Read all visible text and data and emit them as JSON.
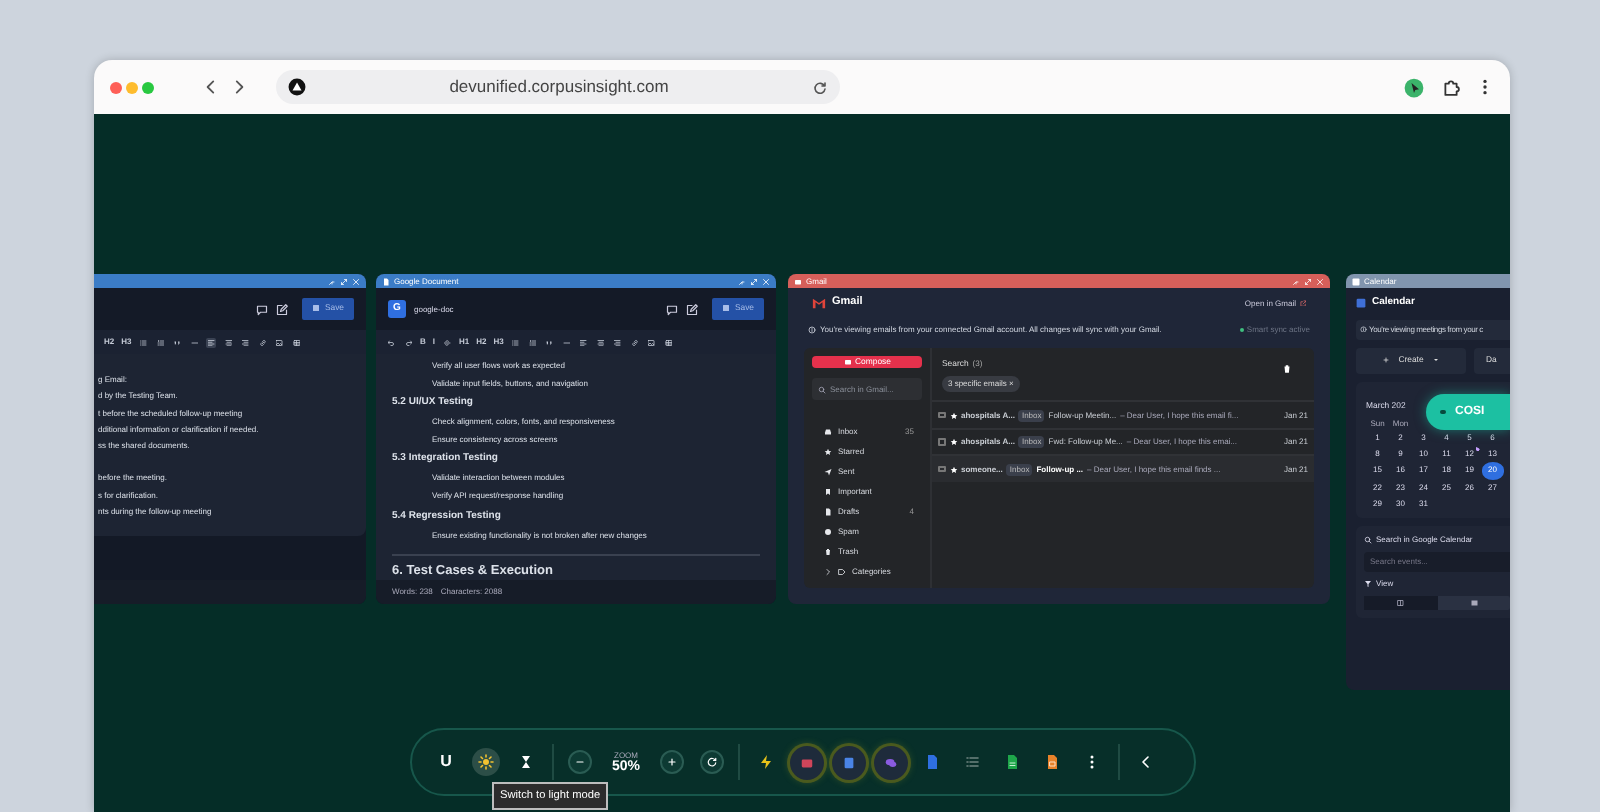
{
  "browser": {
    "url": "devunified.corpusinsight.com"
  },
  "windows": [
    {
      "kind": "doc",
      "save": "Save",
      "toolbar": [
        {
          "kind": "text",
          "label": "H2",
          "selected": false
        },
        {
          "kind": "text",
          "label": "H3",
          "selected": false
        },
        {
          "kind": "icon",
          "selected": false
        },
        {
          "kind": "icon",
          "selected": false
        },
        {
          "kind": "icon",
          "selected": false
        },
        {
          "kind": "icon",
          "selected": false
        },
        {
          "kind": "icon",
          "selected": true
        },
        {
          "kind": "icon",
          "selected": false
        },
        {
          "kind": "icon",
          "selected": false
        },
        {
          "kind": "icon",
          "selected": false
        },
        {
          "kind": "icon",
          "selected": false
        },
        {
          "kind": "icon",
          "selected": false
        }
      ],
      "lines": [
        {
          "kind": "plain",
          "text": "g Email:"
        },
        {
          "kind": "plain",
          "text": "d by the Testing Team."
        },
        {
          "kind": "plain",
          "text": "t before the scheduled follow-up meeting"
        },
        {
          "kind": "plain",
          "text": "dditional information or clarification if needed."
        },
        {
          "kind": "plain",
          "text": "ss the shared documents."
        },
        {
          "kind": "plain",
          "text": "before the meeting.",
          "gap_before": true
        },
        {
          "kind": "plain",
          "text": "s for clarification."
        },
        {
          "kind": "plain",
          "text": "nts during the follow-up meeting"
        }
      ]
    },
    {
      "kind": "doc",
      "title": "Google Document",
      "logo": "G",
      "doc_name": "google-doc",
      "save": "Save",
      "toolbar": [
        {
          "kind": "icon",
          "selected": false
        },
        {
          "kind": "icon",
          "selected": false
        },
        {
          "kind": "text",
          "label": "B",
          "selected": false
        },
        {
          "kind": "text",
          "label": "I",
          "selected": false
        },
        {
          "kind": "icon",
          "selected": false
        },
        {
          "kind": "text",
          "label": "H1",
          "selected": false
        },
        {
          "kind": "text",
          "label": "H2",
          "selected": false
        },
        {
          "kind": "text",
          "label": "H3",
          "selected": false
        },
        {
          "kind": "icon",
          "selected": false
        },
        {
          "kind": "icon",
          "selected": false
        },
        {
          "kind": "icon",
          "selected": false
        },
        {
          "kind": "icon",
          "selected": false
        },
        {
          "kind": "icon",
          "selected": false
        },
        {
          "kind": "icon",
          "selected": false
        },
        {
          "kind": "icon",
          "selected": false
        },
        {
          "kind": "icon",
          "selected": false
        },
        {
          "kind": "icon",
          "selected": false
        },
        {
          "kind": "icon",
          "selected": false
        }
      ],
      "lines": [
        {
          "kind": "bullet",
          "text": "Verify all user flows work as expected"
        },
        {
          "kind": "bullet",
          "text": "Validate input fields, buttons, and navigation"
        },
        {
          "kind": "heading",
          "text": "5.2 UI/UX Testing"
        },
        {
          "kind": "bullet",
          "text": "Check alignment, colors, fonts, and responsiveness"
        },
        {
          "kind": "bullet",
          "text": "Ensure consistency across screens"
        },
        {
          "kind": "heading",
          "text": "5.3 Integration Testing"
        },
        {
          "kind": "bullet",
          "text": "Validate interaction between modules"
        },
        {
          "kind": "bullet",
          "text": "Verify API request/response handling"
        },
        {
          "kind": "heading",
          "text": "5.4 Regression Testing"
        },
        {
          "kind": "bullet",
          "text": "Ensure existing functionality is not broken after new changes"
        },
        {
          "kind": "h1",
          "text": "6. Test Cases & Execution"
        }
      ],
      "footer": [
        "Words: 238",
        "Characters: 2088"
      ]
    },
    {
      "kind": "gmail",
      "title": "Gmail",
      "heading": "Gmail",
      "open_link": "Open in Gmail",
      "notice": "You're viewing emails from your connected Gmail account. All changes will sync with your Gmail.",
      "sync_status": "Smart sync active",
      "compose": "Compose",
      "search_placeholder": "Search in Gmail...",
      "folders": [
        {
          "label": "Inbox",
          "count": "35"
        },
        {
          "label": "Starred"
        },
        {
          "label": "Sent"
        },
        {
          "label": "Important"
        },
        {
          "label": "Drafts",
          "count": "4"
        },
        {
          "label": "Spam"
        },
        {
          "label": "Trash"
        }
      ],
      "categories": "Categories",
      "results_title": "Search",
      "results_count": "(3)",
      "filter_chip": "3 specific emails ×",
      "emails": [
        {
          "sender": "ahospitals A...",
          "label": "Inbox",
          "subject": "Follow-up Meetin...",
          "snippet": "– Dear User, I hope this email fi...",
          "date": "Jan 21",
          "unread": false,
          "checked": false
        },
        {
          "sender": "ahospitals A...",
          "label": "Inbox",
          "subject": "Fwd: Follow-up Me...",
          "snippet": "– Dear User, I hope this emai...",
          "date": "Jan 21",
          "unread": false,
          "checked": false
        },
        {
          "sender": "someone...",
          "label": "Inbox",
          "subject": "Follow-up ...",
          "snippet": "– Dear User, I hope this email finds ...",
          "date": "Jan 21",
          "unread": true,
          "checked": false
        }
      ]
    },
    {
      "kind": "calendar",
      "title": "Calendar",
      "heading": "Calendar",
      "notice": "You're viewing meetings from your c",
      "create": "Create",
      "view_button": "Da",
      "month": "March 202",
      "weekdays": [
        "Sun",
        "Mon"
      ],
      "weeks": [
        [
          {
            "day": "1",
            "selected": false,
            "event": false
          },
          {
            "day": "2",
            "selected": false,
            "event": false
          },
          {
            "day": "3",
            "selected": false,
            "event": false
          },
          {
            "day": "4",
            "selected": false,
            "event": false
          },
          {
            "day": "5",
            "selected": false,
            "event": false
          },
          {
            "day": "6",
            "selected": false,
            "event": false
          }
        ],
        [
          {
            "day": "8",
            "selected": false,
            "event": false
          },
          {
            "day": "9",
            "selected": false,
            "event": false
          },
          {
            "day": "10",
            "selected": false,
            "event": false
          },
          {
            "day": "11",
            "selected": false,
            "event": false
          },
          {
            "day": "12",
            "selected": false,
            "event": true
          },
          {
            "day": "13",
            "selected": false,
            "event": false
          }
        ],
        [
          {
            "day": "15",
            "selected": false,
            "event": false
          },
          {
            "day": "16",
            "selected": false,
            "event": false
          },
          {
            "day": "17",
            "selected": false,
            "event": false
          },
          {
            "day": "18",
            "selected": false,
            "event": false
          },
          {
            "day": "19",
            "selected": false,
            "event": false
          },
          {
            "day": "20",
            "selected": true,
            "event": false
          }
        ],
        [
          {
            "day": "22",
            "selected": false,
            "event": false
          },
          {
            "day": "23",
            "selected": false,
            "event": false
          },
          {
            "day": "24",
            "selected": false,
            "event": false
          },
          {
            "day": "25",
            "selected": false,
            "event": false
          },
          {
            "day": "26",
            "selected": false,
            "event": false
          },
          {
            "day": "27",
            "selected": false,
            "event": false
          }
        ],
        [
          {
            "day": "29",
            "selected": false,
            "event": false
          },
          {
            "day": "30",
            "selected": false,
            "event": false
          },
          {
            "day": "31",
            "selected": false,
            "event": false
          }
        ]
      ],
      "search_label": "Search in Google Calendar",
      "search_placeholder": "Search events...",
      "view_label": "View",
      "view_modes": [
        {
          "selected": true
        },
        {
          "selected": false
        }
      ]
    }
  ],
  "assistant": {
    "label": "COSI"
  },
  "dock": [
    {
      "kind": "text",
      "label": "U"
    },
    {
      "kind": "icon",
      "active": true
    },
    {
      "kind": "icon",
      "active": false
    },
    {
      "kind": "divider"
    },
    {
      "kind": "icon",
      "active": false
    },
    {
      "kind": "zoom",
      "label": "ZOOM",
      "value": "50%"
    },
    {
      "kind": "icon",
      "active": false
    },
    {
      "kind": "icon",
      "active": false
    },
    {
      "kind": "divider"
    },
    {
      "kind": "icon",
      "active": false
    },
    {
      "kind": "icon",
      "active": true
    },
    {
      "kind": "icon",
      "active": true
    },
    {
      "kind": "icon",
      "active": true
    },
    {
      "kind": "icon",
      "active": false
    },
    {
      "kind": "icon",
      "active": false
    },
    {
      "kind": "icon",
      "active": false
    },
    {
      "kind": "icon",
      "active": false
    },
    {
      "kind": "icon",
      "active": false
    },
    {
      "kind": "divider"
    },
    {
      "kind": "icon",
      "active": false
    }
  ],
  "tooltip": "Switch to light mode"
}
